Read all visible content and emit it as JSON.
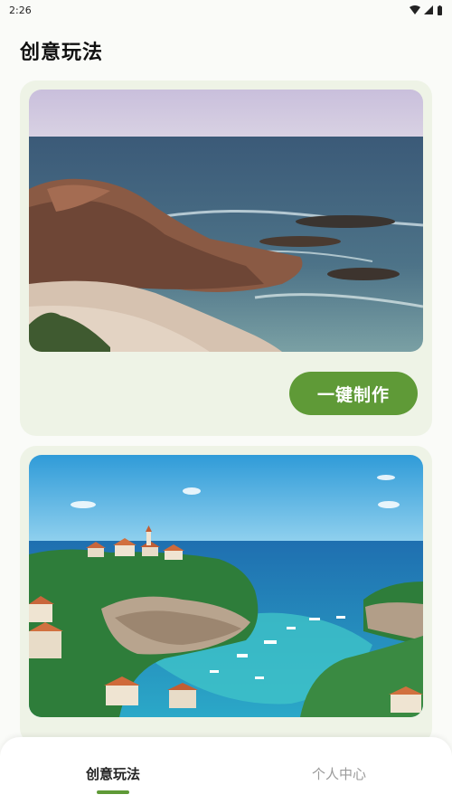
{
  "status_bar": {
    "time": "2:26"
  },
  "page": {
    "title": "创意玩法"
  },
  "cards": [
    {
      "image": "rocky-coast-photo",
      "button_label": "一键制作"
    },
    {
      "image": "cliffside-harbor-illustration"
    }
  ],
  "bottom_nav": {
    "tabs": [
      {
        "label": "创意玩法",
        "active": true
      },
      {
        "label": "个人中心",
        "active": false
      }
    ]
  },
  "colors": {
    "accent": "#5f9a37",
    "card_bg": "#eef3e6"
  }
}
